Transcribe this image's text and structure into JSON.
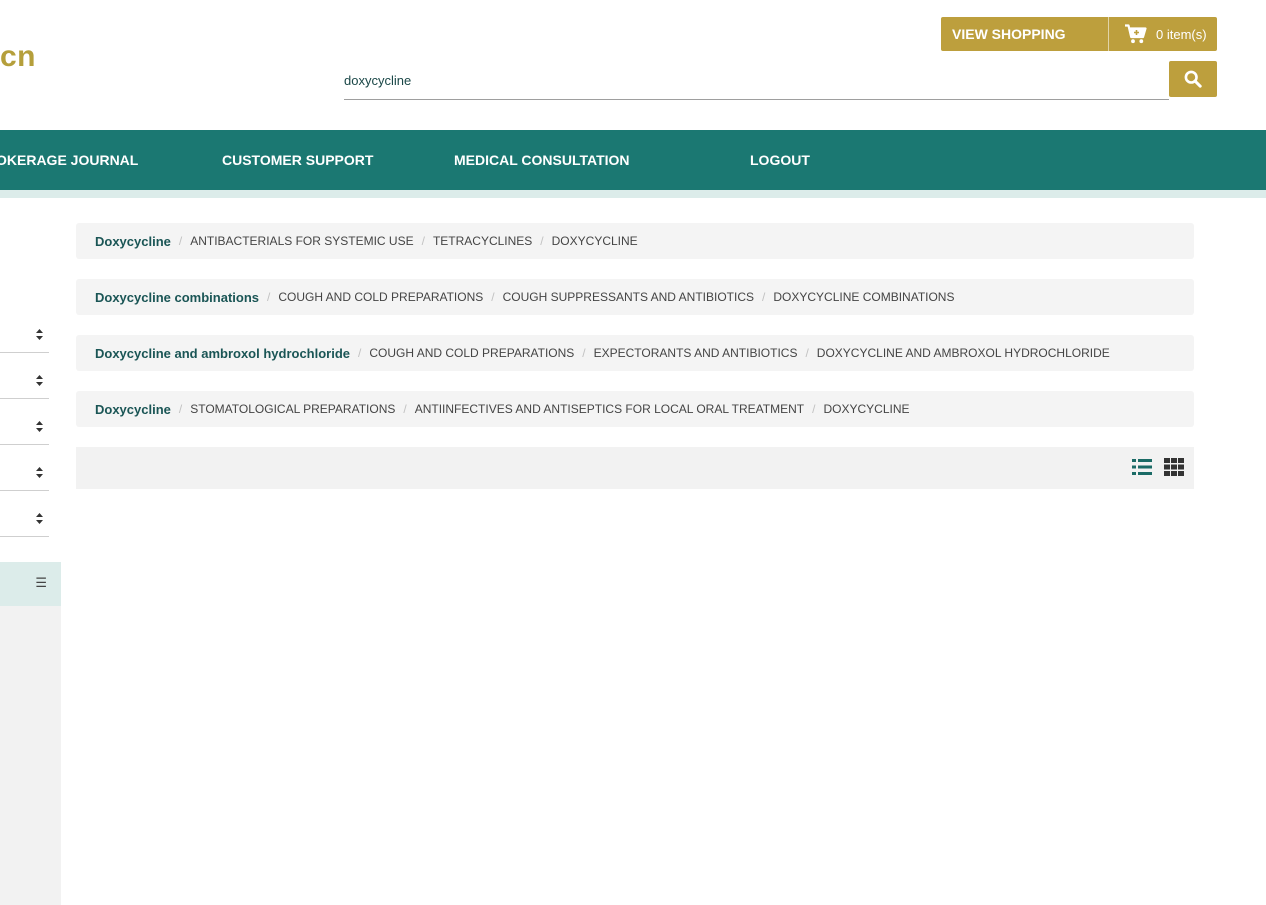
{
  "header": {
    "logo_text": "cn",
    "cart": {
      "label": "VIEW SHOPPING CART",
      "count": "0 item(s)",
      "icon": "shopping-cart-icon"
    },
    "search": {
      "value": "doxycycline",
      "icon": "search-icon"
    }
  },
  "nav": {
    "items": [
      {
        "label": "OKERAGE JOURNAL"
      },
      {
        "label": "CUSTOMER SUPPORT"
      },
      {
        "label": "MEDICAL CONSULTATION"
      },
      {
        "label": "LOGOUT"
      }
    ]
  },
  "sidebar": {
    "select_icon": "sort-arrows-icon",
    "toggle_icon_text": "☰"
  },
  "results": [
    {
      "name": "Doxycycline",
      "path": [
        "ANTIBACTERIALS FOR SYSTEMIC USE",
        "TETRACYCLINES",
        "DOXYCYCLINE"
      ]
    },
    {
      "name": "Doxycycline combinations",
      "path": [
        "COUGH AND COLD PREPARATIONS",
        "COUGH SUPPRESSANTS AND ANTIBIOTICS",
        "DOXYCYCLINE COMBINATIONS"
      ]
    },
    {
      "name": "Doxycycline and ambroxol hydrochloride",
      "path": [
        "COUGH AND COLD PREPARATIONS",
        "EXPECTORANTS AND ANTIBIOTICS",
        "DOXYCYCLINE AND AMBROXOL HYDROCHLORIDE"
      ]
    },
    {
      "name": "Doxycycline",
      "path": [
        "STOMATOLOGICAL PREPARATIONS",
        "ANTIINFECTIVES AND ANTISEPTICS FOR LOCAL ORAL TREATMENT",
        "DOXYCYCLINE"
      ]
    }
  ],
  "breadcrumb_separator": "/",
  "view_toggle": {
    "list_icon": "list-view-icon",
    "grid_icon": "grid-view-icon"
  },
  "colors": {
    "gold": "#bd9f3d",
    "teal": "#1b7872",
    "teal_dark": "#1a5555"
  }
}
